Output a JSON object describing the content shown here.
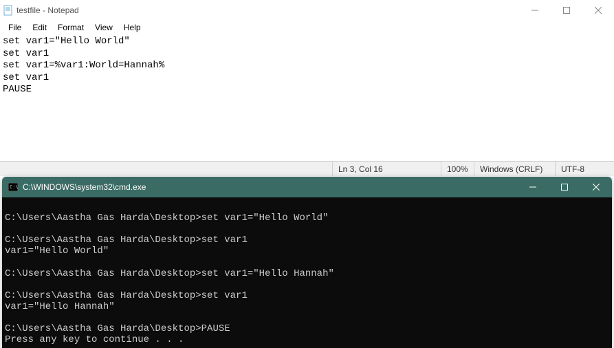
{
  "notepad": {
    "title": "testfile - Notepad",
    "menu": [
      "File",
      "Edit",
      "Format",
      "View",
      "Help"
    ],
    "content": "set var1=\"Hello World\"\nset var1\nset var1=%var1:World=Hannah%\nset var1\nPAUSE",
    "status": {
      "position": "Ln 3, Col 16",
      "zoom": "100%",
      "line_ending": "Windows (CRLF)",
      "encoding": "UTF-8"
    }
  },
  "cmd": {
    "title": "C:\\WINDOWS\\system32\\cmd.exe",
    "output": "\nC:\\Users\\Aastha Gas Harda\\Desktop>set var1=\"Hello World\"\n\nC:\\Users\\Aastha Gas Harda\\Desktop>set var1\nvar1=\"Hello World\"\n\nC:\\Users\\Aastha Gas Harda\\Desktop>set var1=\"Hello Hannah\"\n\nC:\\Users\\Aastha Gas Harda\\Desktop>set var1\nvar1=\"Hello Hannah\"\n\nC:\\Users\\Aastha Gas Harda\\Desktop>PAUSE\nPress any key to continue . . ."
  }
}
